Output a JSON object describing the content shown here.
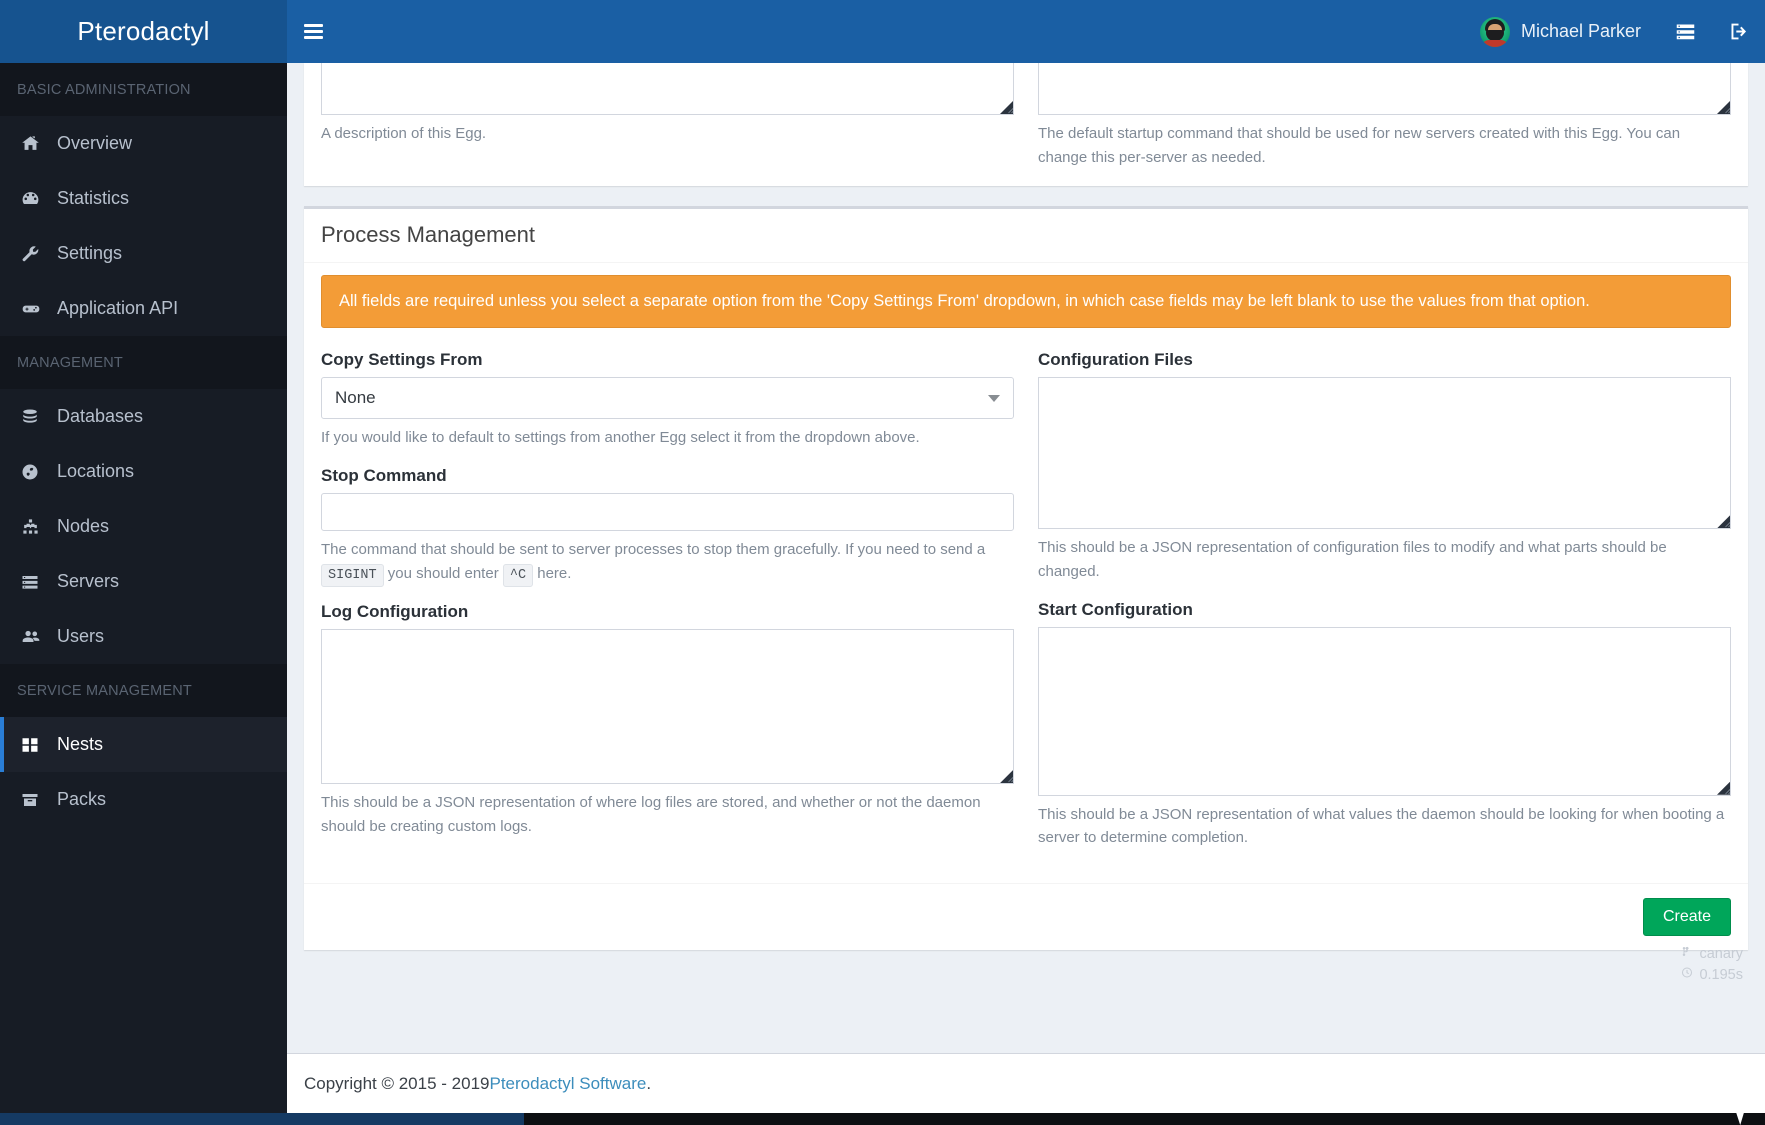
{
  "brand": {
    "title": "Pterodactyl"
  },
  "sidebar": {
    "sections": [
      {
        "header": "BASIC ADMINISTRATION",
        "items": [
          {
            "label": "Overview",
            "icon": "home-icon",
            "active": false
          },
          {
            "label": "Statistics",
            "icon": "dashboard-icon",
            "active": false
          },
          {
            "label": "Settings",
            "icon": "wrench-icon",
            "active": false
          },
          {
            "label": "Application API",
            "icon": "gamepad-icon",
            "active": false
          }
        ]
      },
      {
        "header": "MANAGEMENT",
        "items": [
          {
            "label": "Databases",
            "icon": "database-icon",
            "active": false
          },
          {
            "label": "Locations",
            "icon": "globe-icon",
            "active": false
          },
          {
            "label": "Nodes",
            "icon": "sitemap-icon",
            "active": false
          },
          {
            "label": "Servers",
            "icon": "server-icon",
            "active": false
          },
          {
            "label": "Users",
            "icon": "users-icon",
            "active": false
          }
        ]
      },
      {
        "header": "SERVICE MANAGEMENT",
        "items": [
          {
            "label": "Nests",
            "icon": "th-large-icon",
            "active": true
          },
          {
            "label": "Packs",
            "icon": "archive-icon",
            "active": false
          }
        ]
      }
    ]
  },
  "topbar": {
    "menu_toggle": "hamburger-icon",
    "user_name": "Michael Parker",
    "server_icon": "server-icon",
    "signout_icon": "sign-out-icon"
  },
  "top_card": {
    "left_help": "A description of this Egg.",
    "right_help": "The default startup command that should be used for new servers created with this Egg. You can change this per-server as needed."
  },
  "process_management": {
    "title": "Process Management",
    "alert": "All fields are required unless you select a separate option from the 'Copy Settings From' dropdown, in which case fields may be left blank to use the values from that option.",
    "fields": {
      "copy_settings_from": {
        "label": "Copy Settings From",
        "value": "None",
        "help": "If you would like to default to settings from another Egg select it from the dropdown above."
      },
      "stop_command": {
        "label": "Stop Command",
        "value": "",
        "help_part1": "The command that should be sent to server processes to stop them gracefully. If you need to send a",
        "help_code1": "SIGINT",
        "help_part2": "you should enter",
        "help_code2": "^C",
        "help_part3": "here."
      },
      "log_configuration": {
        "label": "Log Configuration",
        "value": "",
        "help": "This should be a JSON representation of where log files are stored, and whether or not the daemon should be creating custom logs."
      },
      "configuration_files": {
        "label": "Configuration Files",
        "value": "",
        "help": "This should be a JSON representation of configuration files to modify and what parts should be changed."
      },
      "start_configuration": {
        "label": "Start Configuration",
        "value": "",
        "help": "This should be a JSON representation of what values the daemon should be looking for when booting a server to determine completion."
      }
    },
    "submit_label": "Create"
  },
  "footer": {
    "copyright_prefix": "Copyright © 2015 - 2019 ",
    "link_label": "Pterodactyl Software",
    "copyright_suffix": "."
  },
  "version_info": {
    "branch": "canary",
    "load_time": "0.195s"
  },
  "colors": {
    "brand_blue": "#16538f",
    "topbar_blue": "#1a5fa4",
    "sidebar_dark": "#171c25",
    "active_accent": "#2a7ed6",
    "alert_orange": "#f39c37",
    "success_green": "#00a65a",
    "link_blue": "#3c8dbc"
  }
}
